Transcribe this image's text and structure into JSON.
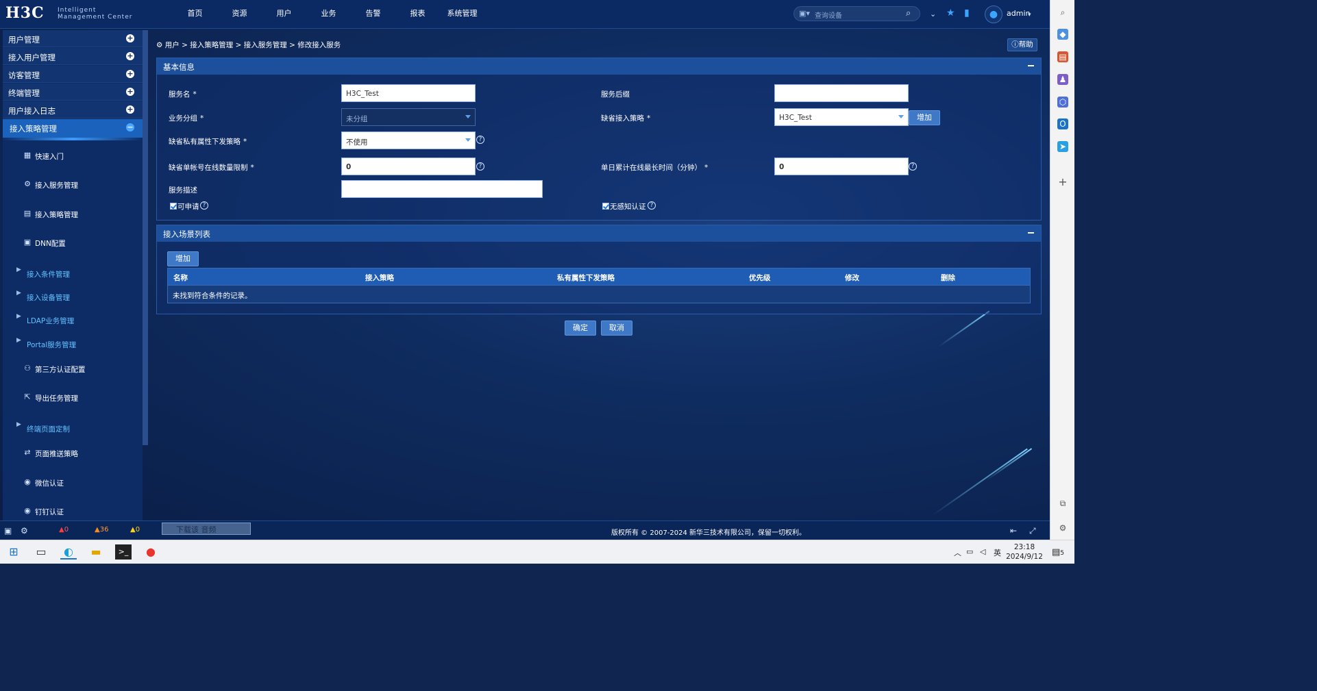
{
  "brand": {
    "logo": "H3C",
    "sub_line1": "Intelligent",
    "sub_line2": "Management Center"
  },
  "nav": [
    "首页",
    "资源",
    "用户",
    "业务",
    "告警",
    "报表",
    "系统管理"
  ],
  "search": {
    "placeholder": "查询设备"
  },
  "user": {
    "name": "admin"
  },
  "sidebar": {
    "menus": [
      "用户管理",
      "接入用户管理",
      "访客管理",
      "终端管理",
      "用户接入日志",
      "接入策略管理"
    ],
    "subs": [
      {
        "label": "快速入门",
        "icon": "quick-start-icon"
      },
      {
        "label": "接入服务管理",
        "icon": "service-icon"
      },
      {
        "label": "接入策略管理",
        "icon": "policy-icon"
      },
      {
        "label": "DNN配置",
        "icon": "dnn-icon"
      },
      {
        "label": "接入条件管理",
        "expandable": true
      },
      {
        "label": "接入设备管理",
        "expandable": true
      },
      {
        "label": "LDAP业务管理",
        "expandable": true
      },
      {
        "label": "Portal服务管理",
        "expandable": true
      },
      {
        "label": "第三方认证配置",
        "icon": "third-party-icon"
      },
      {
        "label": "导出任务管理",
        "icon": "export-icon"
      },
      {
        "label": "终端页面定制",
        "expandable": true
      },
      {
        "label": "页面推送策略",
        "icon": "push-icon"
      },
      {
        "label": "微信认证",
        "icon": "wechat-icon"
      },
      {
        "label": "钉钉认证",
        "icon": "dingtalk-icon"
      }
    ]
  },
  "breadcrumb": {
    "items": [
      "用户",
      "接入策略管理",
      "接入服务管理",
      "修改接入服务"
    ],
    "sep": ">"
  },
  "help_label": "帮助",
  "basic": {
    "title": "基本信息",
    "service_name_label": "服务名",
    "service_name_value": "H3C_Test",
    "suffix_label": "服务后缀",
    "suffix_value": "",
    "group_label": "业务分组",
    "group_value": "未分组",
    "default_policy_label": "缺省接入策略",
    "default_policy_value": "H3C_Test",
    "add_label": "增加",
    "private_attr_label": "缺省私有属性下发策略",
    "private_attr_value": "不使用",
    "online_limit_label": "缺省单帐号在线数量限制",
    "online_limit_value": "0",
    "daily_time_label": "单日累计在线最长时间（分钟）",
    "daily_time_value": "0",
    "desc_label": "服务描述",
    "desc_value": "",
    "applicable_label": "可申请",
    "nonaware_label": "无感知认证",
    "required_mark": "*",
    "help_mark": "?"
  },
  "scene": {
    "title": "接入场景列表",
    "add_label": "增加",
    "columns": [
      "名称",
      "接入策略",
      "私有属性下发策略",
      "优先级",
      "修改",
      "删除"
    ],
    "empty_text": "未找到符合条件的记录。"
  },
  "actions": {
    "ok": "确定",
    "cancel": "取消"
  },
  "footer": {
    "copyright": "版权所有 © 2007-2024 新华三技术有限公司，保留一切权利。",
    "alert_critical": "0",
    "alert_major": "36",
    "alert_minor": "0",
    "download_bar": "下载该 音频"
  },
  "taskbar": {
    "ime": "英",
    "time": "23:18",
    "date": "2024/9/12",
    "notif_count": "5"
  },
  "colors": {
    "header": "#0b2a63",
    "panel_header": "#1c4f9c",
    "active_menu": "#1b62bd",
    "button": "#3f78c7"
  }
}
